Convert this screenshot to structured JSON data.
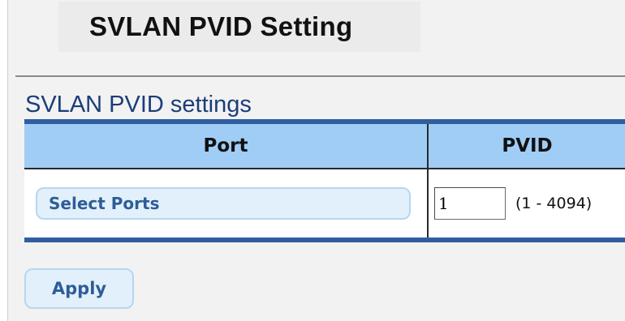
{
  "header": {
    "title": "SVLAN PVID Setting"
  },
  "section": {
    "title": "SVLAN PVID settings"
  },
  "table": {
    "columns": [
      "Port",
      "PVID"
    ],
    "row": {
      "select_ports_label": "Select Ports",
      "pvid_value": "1",
      "pvid_range": "(1 - 4094)"
    }
  },
  "actions": {
    "apply_label": "Apply"
  },
  "colors": {
    "header_row_bg": "#9fcdf6",
    "table_border": "#2f5e9e",
    "button_bg": "#e2f0fc",
    "button_text": "#2e5d96",
    "section_title": "#1b3d78"
  }
}
